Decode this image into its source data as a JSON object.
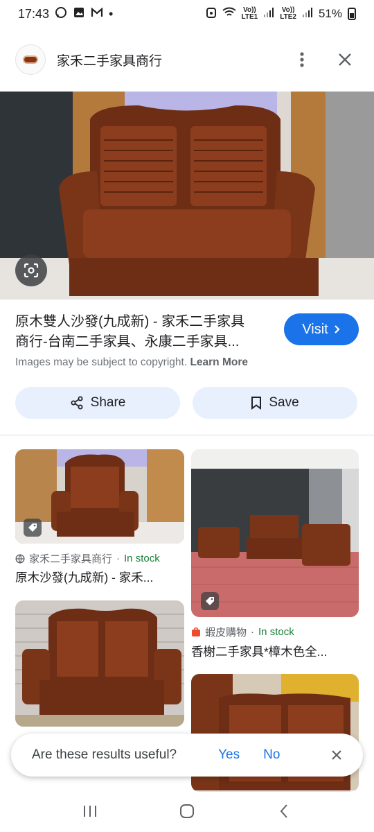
{
  "status_bar": {
    "time": "17:43",
    "dot": "•",
    "volte1_top": "Vo))",
    "volte1_bottom": "LTE1",
    "volte2_top": "Vo))",
    "volte2_bottom": "LTE2",
    "battery": "51%"
  },
  "header": {
    "site_name": "家禾二手家具商行",
    "more_icon": "more-vert-icon",
    "close_icon": "close-icon"
  },
  "result": {
    "title_line1": "原木雙人沙發(九成新) - 家禾二手家具",
    "title_line2": "商行-台南二手家具、永康二手家具...",
    "visit_label": "Visit",
    "copyright_text": "Images may be subject to copyright.",
    "learn_more": "Learn More",
    "share_label": "Share",
    "save_label": "Save"
  },
  "grid": {
    "cards": [
      {
        "source": "家禾二手家具商行",
        "separator": "·",
        "stock": "In stock",
        "title": "原木沙發(九成新) - 家禾..."
      },
      {
        "source": "蝦皮購物",
        "separator": "·",
        "stock": "In stock",
        "title": "香榭二手家具*樟木色全..."
      }
    ]
  },
  "feedback": {
    "question": "Are these results useful?",
    "yes": "Yes",
    "no": "No"
  },
  "colors": {
    "accent": "#1a73e8",
    "stock_green": "#188038",
    "chip_bg": "#e8f0fe",
    "wood": "#7a3518"
  }
}
